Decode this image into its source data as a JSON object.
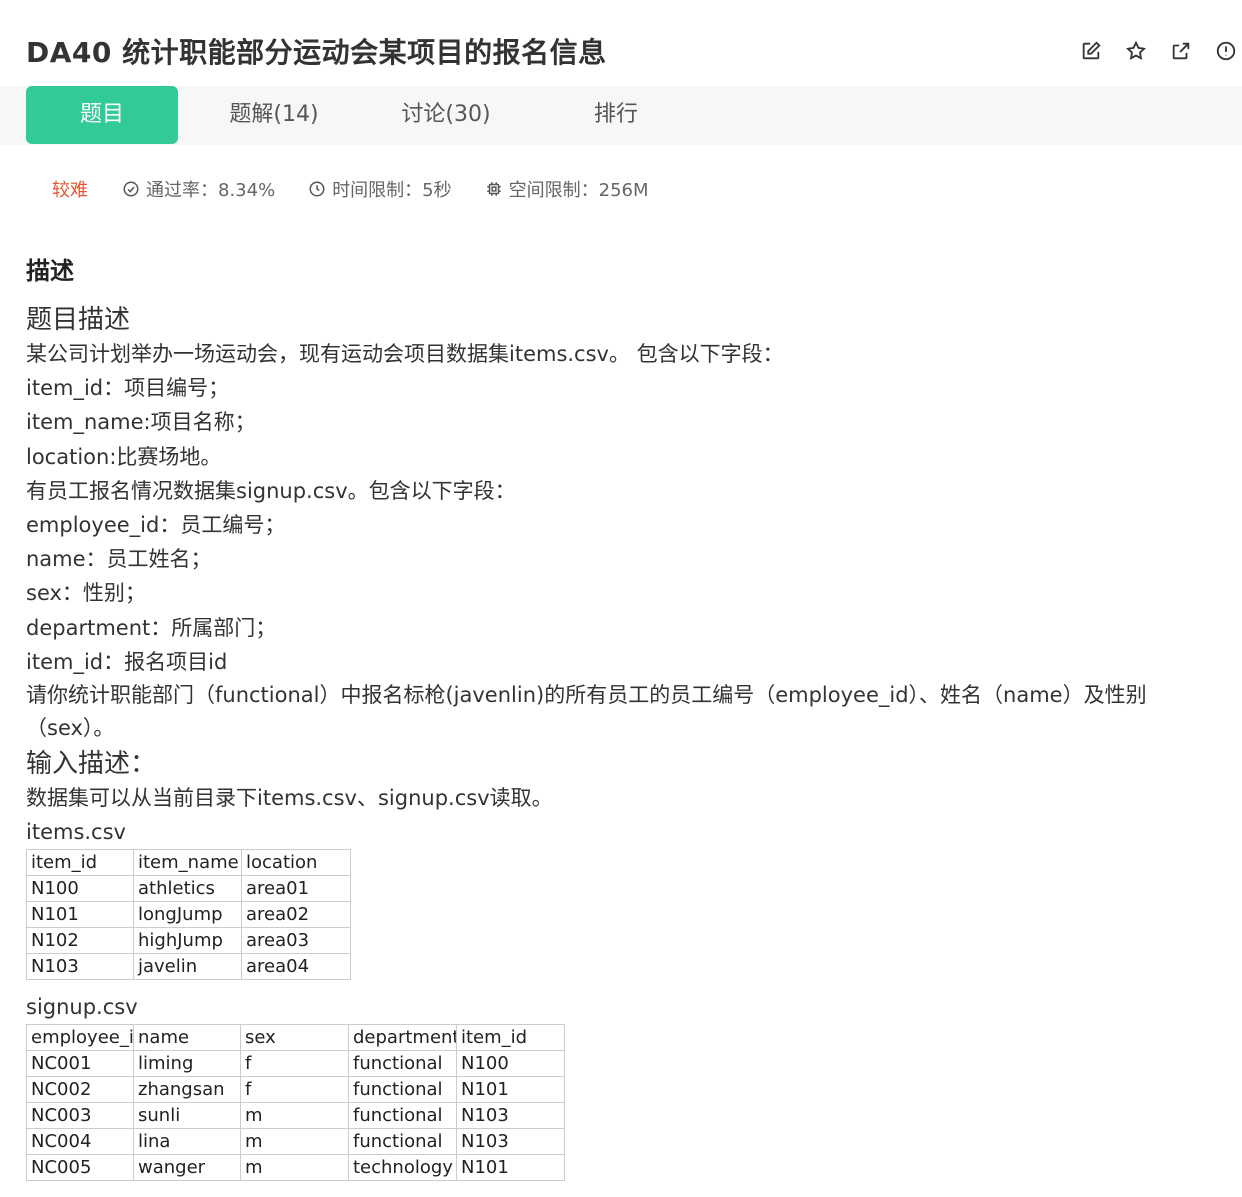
{
  "header": {
    "title": "DA40  统计职能部分运动会某项目的报名信息",
    "action_icons": [
      "edit-icon",
      "star-icon",
      "external-link-icon",
      "report-icon"
    ]
  },
  "tabs": [
    {
      "label": "题目",
      "active": true
    },
    {
      "label": "题解(14)",
      "active": false
    },
    {
      "label": "讨论(30)",
      "active": false
    },
    {
      "label": "排行",
      "active": false
    }
  ],
  "meta": {
    "difficulty": "较难",
    "pass_rate": "通过率：8.34%",
    "time_limit": "时间限制：5秒",
    "space_limit": "空间限制：256M"
  },
  "section_heading": "描述",
  "problem": {
    "heading": "题目描述",
    "lines": [
      "某公司计划举办一场运动会，现有运动会项目数据集items.csv。 包含以下字段：",
      "item_id：项目编号；",
      "item_name:项目名称；",
      "location:比赛场地。",
      "有员工报名情况数据集signup.csv。包含以下字段：",
      "employee_id：员工编号；",
      "name：员工姓名；",
      "sex：性别；",
      "department：所属部门；",
      "item_id：报名项目id"
    ],
    "task": "请你统计职能部门（functional）中报名标枪(javenlin)的所有员工的员工编号（employee_id）、姓名（name）及性别（sex）。"
  },
  "input": {
    "heading": "输入描述：",
    "text": "数据集可以从当前目录下items.csv、signup.csv读取。"
  },
  "items_table": {
    "caption": "items.csv",
    "rows": [
      [
        "item_id",
        "item_name",
        "location"
      ],
      [
        "N100",
        "athletics",
        "area01"
      ],
      [
        "N101",
        "longJump",
        "area02"
      ],
      [
        "N102",
        "highJump",
        "area03"
      ],
      [
        "N103",
        "javelin",
        "area04"
      ]
    ]
  },
  "signup_table": {
    "caption": "signup.csv",
    "rows": [
      [
        "employee_id",
        "name",
        "sex",
        "department",
        "item_id"
      ],
      [
        "NC001",
        "liming",
        "f",
        "functional",
        "N100"
      ],
      [
        "NC002",
        "zhangsan",
        "f",
        "functional",
        "N101"
      ],
      [
        "NC003",
        "sunli",
        "m",
        "functional",
        "N103"
      ],
      [
        "NC004",
        "lina",
        "m",
        "functional",
        "N103"
      ],
      [
        "NC005",
        "wanger",
        "m",
        "technology",
        "N101"
      ]
    ]
  }
}
